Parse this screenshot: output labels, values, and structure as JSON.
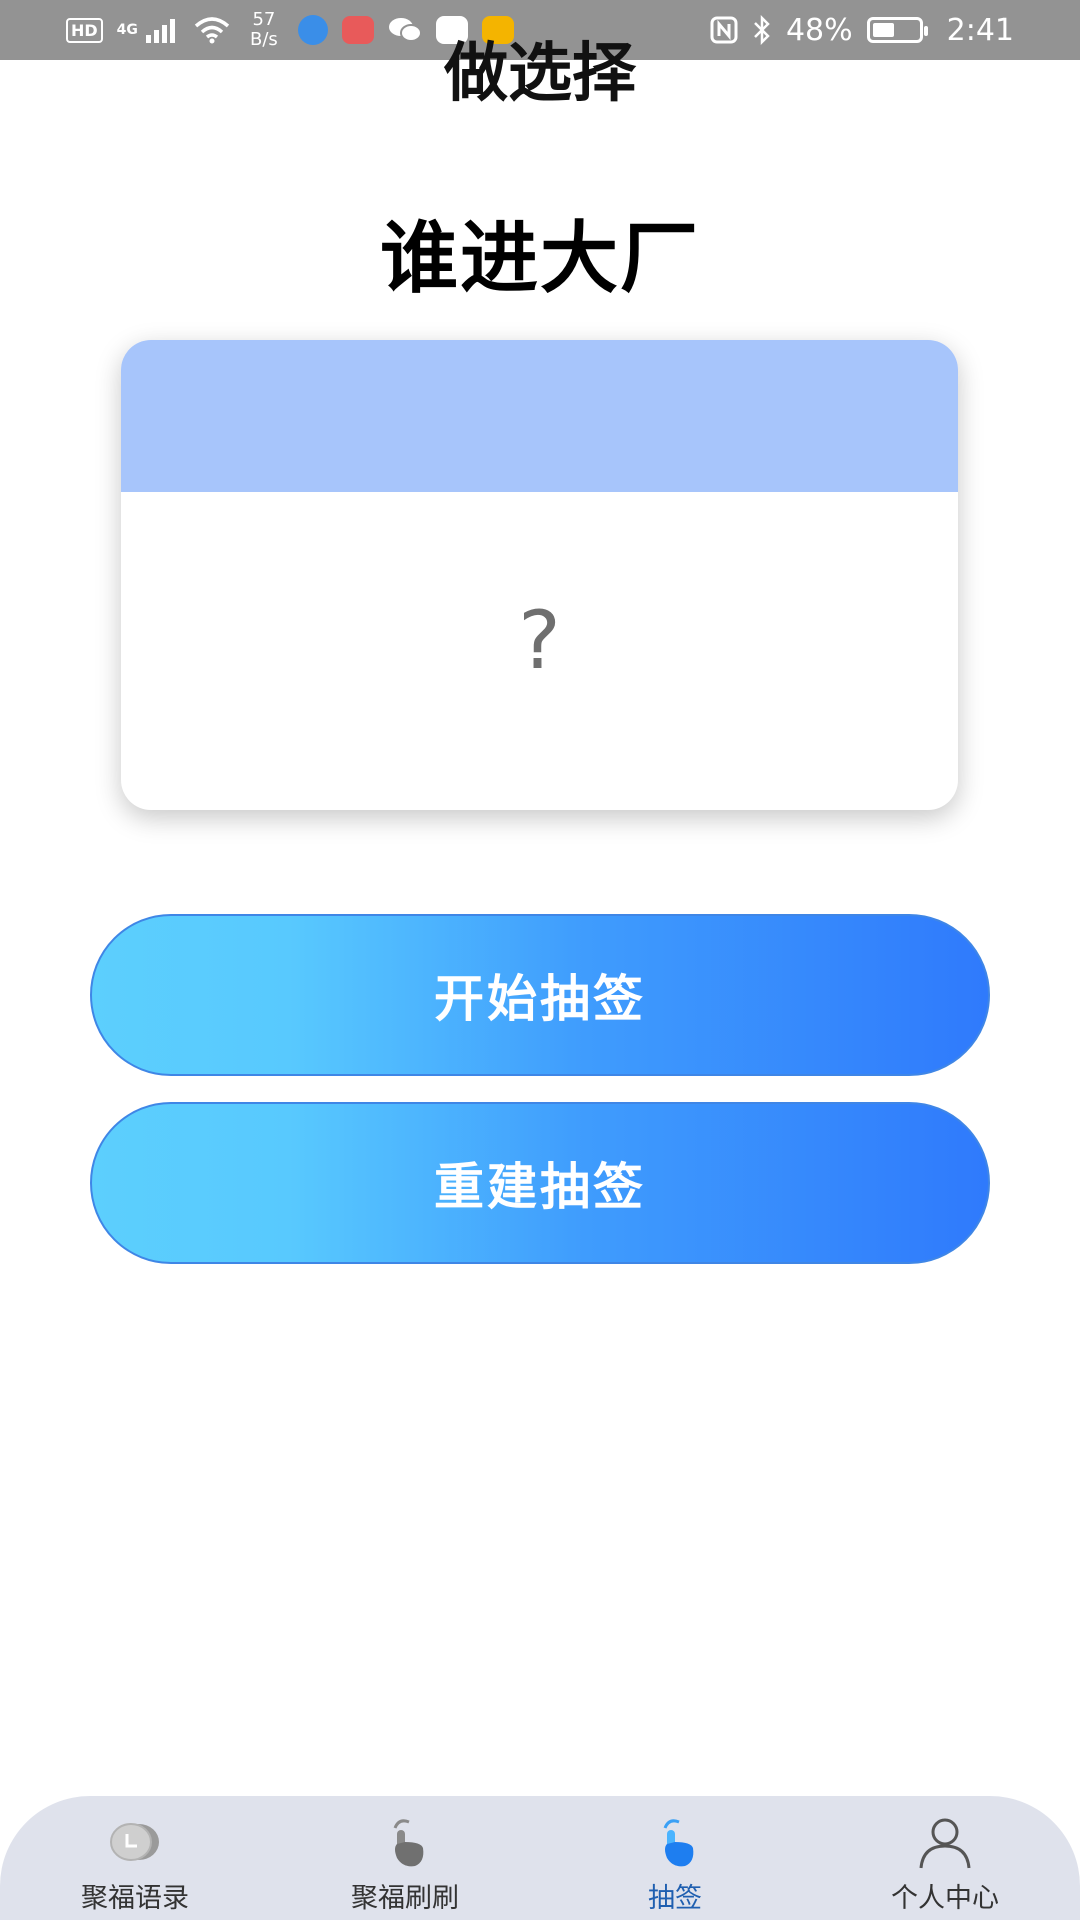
{
  "status_bar": {
    "hd": "HD",
    "network": "4G",
    "speed_value": "57",
    "speed_unit": "B/s",
    "battery": "48%",
    "battery_level": 0.48,
    "time": "2:41",
    "app_icon_colors": [
      "#3a8ee8",
      "#e85a5a",
      "#ffffff",
      "#1e7de0",
      "#f4b400"
    ]
  },
  "header": {
    "title": "做选择"
  },
  "question": "谁进大厂",
  "card": {
    "result": "?",
    "header_color": "#a7c5fb"
  },
  "buttons": {
    "start_label": "开始抽签",
    "rebuild_label": "重建抽签"
  },
  "tabs": [
    {
      "label": "聚福语录",
      "icon": "coin-icon",
      "active": false
    },
    {
      "label": "聚福刷刷",
      "icon": "tap-hand-icon",
      "active": false
    },
    {
      "label": "抽签",
      "icon": "tap-hand-icon",
      "active": true
    },
    {
      "label": "个人中心",
      "icon": "user-icon",
      "active": false
    }
  ],
  "colors": {
    "accent": "#2f7afc",
    "gradient_start": "#5ccffd",
    "tab_active": "#1f5fb0",
    "tab_bar_bg": "#dfe2ec"
  }
}
